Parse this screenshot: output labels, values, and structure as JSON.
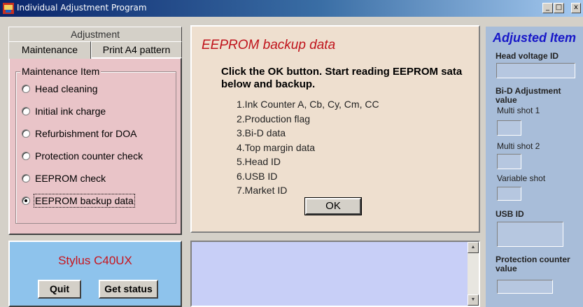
{
  "window": {
    "title": "Individual Adjustment Program",
    "minimize": "_",
    "maximize": "□",
    "close": "x"
  },
  "tabs": {
    "header": "Adjustment",
    "items": [
      {
        "label": "Maintenance",
        "active": true
      },
      {
        "label": "Print A4 pattern",
        "active": false
      }
    ]
  },
  "maintenance": {
    "group_title": "Maintenance Item",
    "items": [
      {
        "label": "Head cleaning",
        "selected": false
      },
      {
        "label": "Initial ink charge",
        "selected": false
      },
      {
        "label": "Refurbishment for DOA",
        "selected": false
      },
      {
        "label": "Protection counter check",
        "selected": false
      },
      {
        "label": "EEPROM check",
        "selected": false
      },
      {
        "label": "EEPROM backup data",
        "selected": true
      }
    ]
  },
  "center": {
    "title": "EEPROM backup data",
    "message": "Click the OK button. Start reading EEPROM sata below and backup.",
    "list": [
      "1.Ink Counter A, Cb, Cy, Cm, CC",
      "2.Production flag",
      "3.Bi-D data",
      "4.Top margin data",
      "5.Head ID",
      "6.USB ID",
      "7.Market ID"
    ],
    "ok_label": "OK"
  },
  "right_panel": {
    "title": "Adjusted Item",
    "head_voltage_label": "Head voltage ID",
    "bid_label_line1": "Bi-D Adjustment",
    "bid_label_line2": "value",
    "multi_shot_1": "Multi shot 1",
    "multi_shot_2": "Multi shot 2",
    "variable_shot": "Variable shot",
    "usb_id_label": "USB ID",
    "protection_line1": "Protection counter",
    "protection_line2": "value"
  },
  "bottom": {
    "model": "Stylus C40UX",
    "quit_label": "Quit",
    "get_status_label": "Get status"
  },
  "colors": {
    "title_accent": "#c0141c",
    "right_title": "#1818c8",
    "maintenance_bg": "#e9c4c8",
    "center_bg": "#eedfcf",
    "status_bg": "#8ec3ec",
    "log_bg": "#c8cff7",
    "right_bg": "#a8bdd9"
  }
}
